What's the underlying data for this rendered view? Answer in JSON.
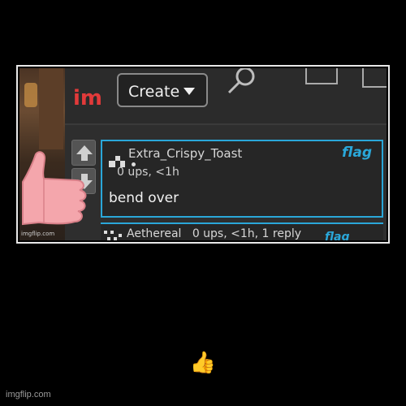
{
  "app": {
    "logo_text": "im",
    "create_label": "Create"
  },
  "comment": {
    "username": "Extra_Crispy_Toast",
    "meta": "0 ups, <1h",
    "flag_label": "flag",
    "body": "bend over"
  },
  "next_comment": {
    "username": "Aethereal",
    "meta": "0 ups, <1h, 1 reply",
    "flag_label": "flag"
  },
  "watermark_small": "imgflip.com",
  "caption": "👍",
  "footer": "imgflip.com",
  "colors": {
    "accent_blue": "#2aa7d9",
    "logo_red": "#e23a3a",
    "background": "#000000"
  },
  "icons": [
    "search-icon",
    "upvote-arrow-icon",
    "downvote-arrow-icon",
    "thumbs-up-icon"
  ]
}
